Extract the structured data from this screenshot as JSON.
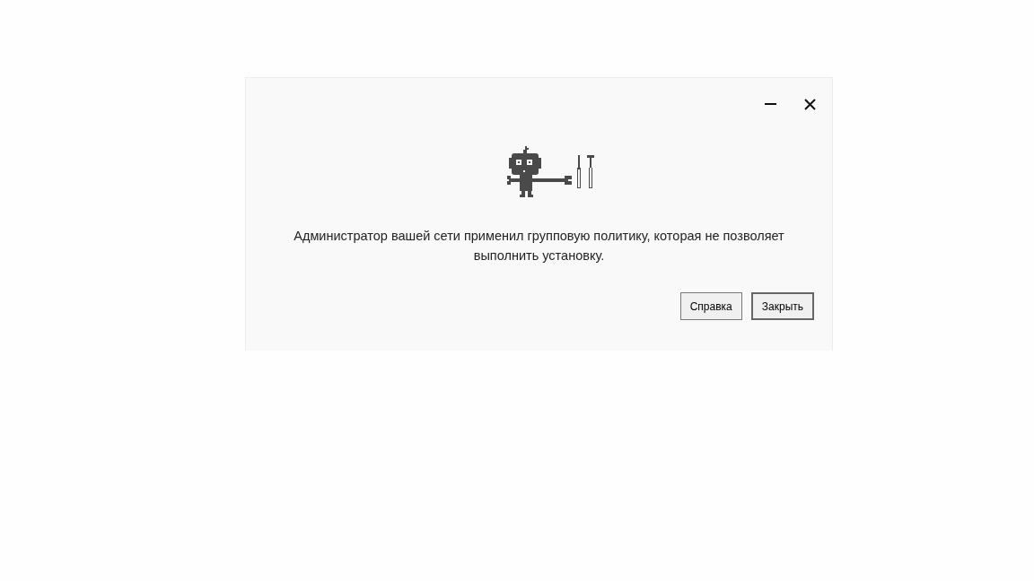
{
  "dialog": {
    "message": "Администратор вашей сети применил групповую политику, которая не позволяет выполнить установку.",
    "buttons": [
      {
        "label": "Справка",
        "default": false
      },
      {
        "label": "Закрыть",
        "default": true
      }
    ]
  }
}
